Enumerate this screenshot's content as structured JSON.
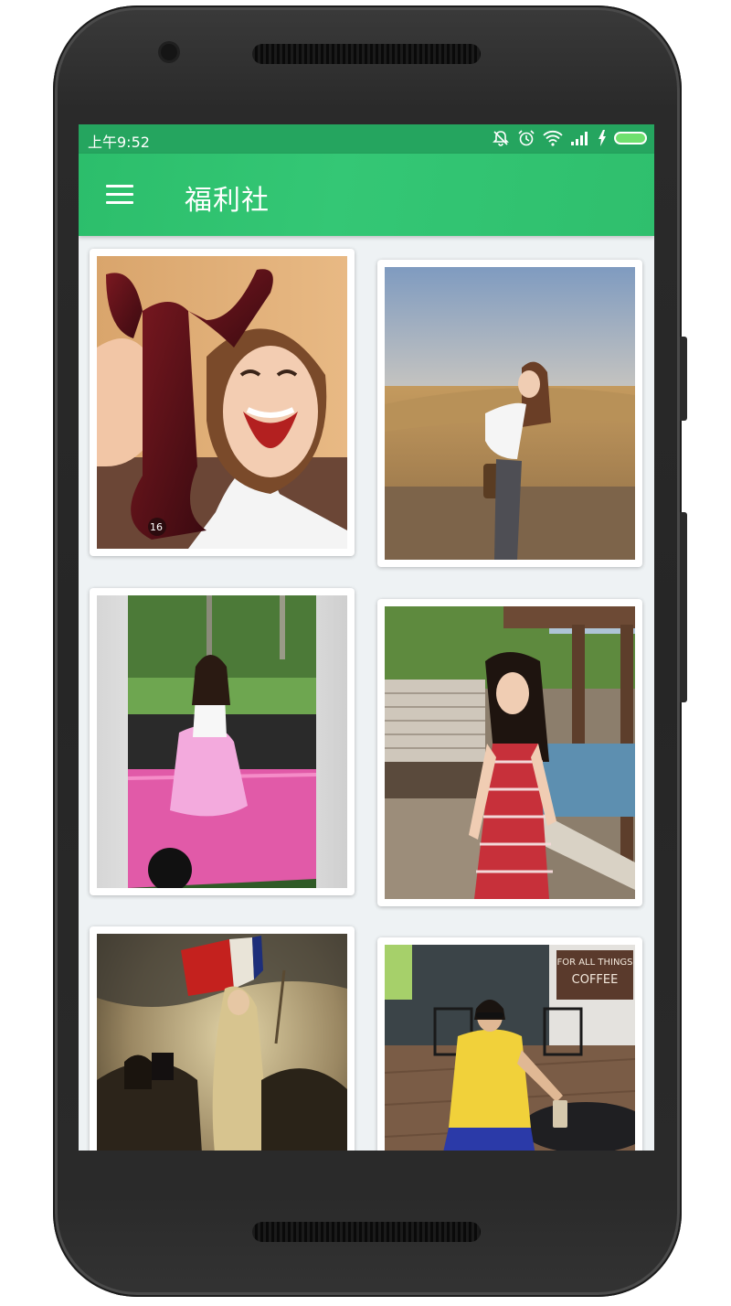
{
  "status_bar": {
    "time": "上午9:52",
    "icons": [
      "mute-icon",
      "alarm-icon",
      "wifi-icon",
      "signal-icon",
      "charging-icon",
      "battery-icon"
    ]
  },
  "app_bar": {
    "title": "福利社",
    "menu_icon": "hamburger-icon"
  },
  "colors": {
    "primary": "#2fbf6d",
    "status_bar": "#25a55f",
    "background": "#eef2f4"
  },
  "gallery": {
    "photos": [
      {
        "subject": "woman-with-lobster-toy",
        "toy_label": "16"
      },
      {
        "subject": "woman-in-field"
      },
      {
        "subject": "woman-on-pink-car"
      },
      {
        "subject": "woman-in-red-dress"
      },
      {
        "subject": "liberty-leading-painting"
      },
      {
        "subject": "woman-at-cafe",
        "signs": [
          "FOR ALL THINGS",
          "COFFEE"
        ]
      }
    ]
  }
}
